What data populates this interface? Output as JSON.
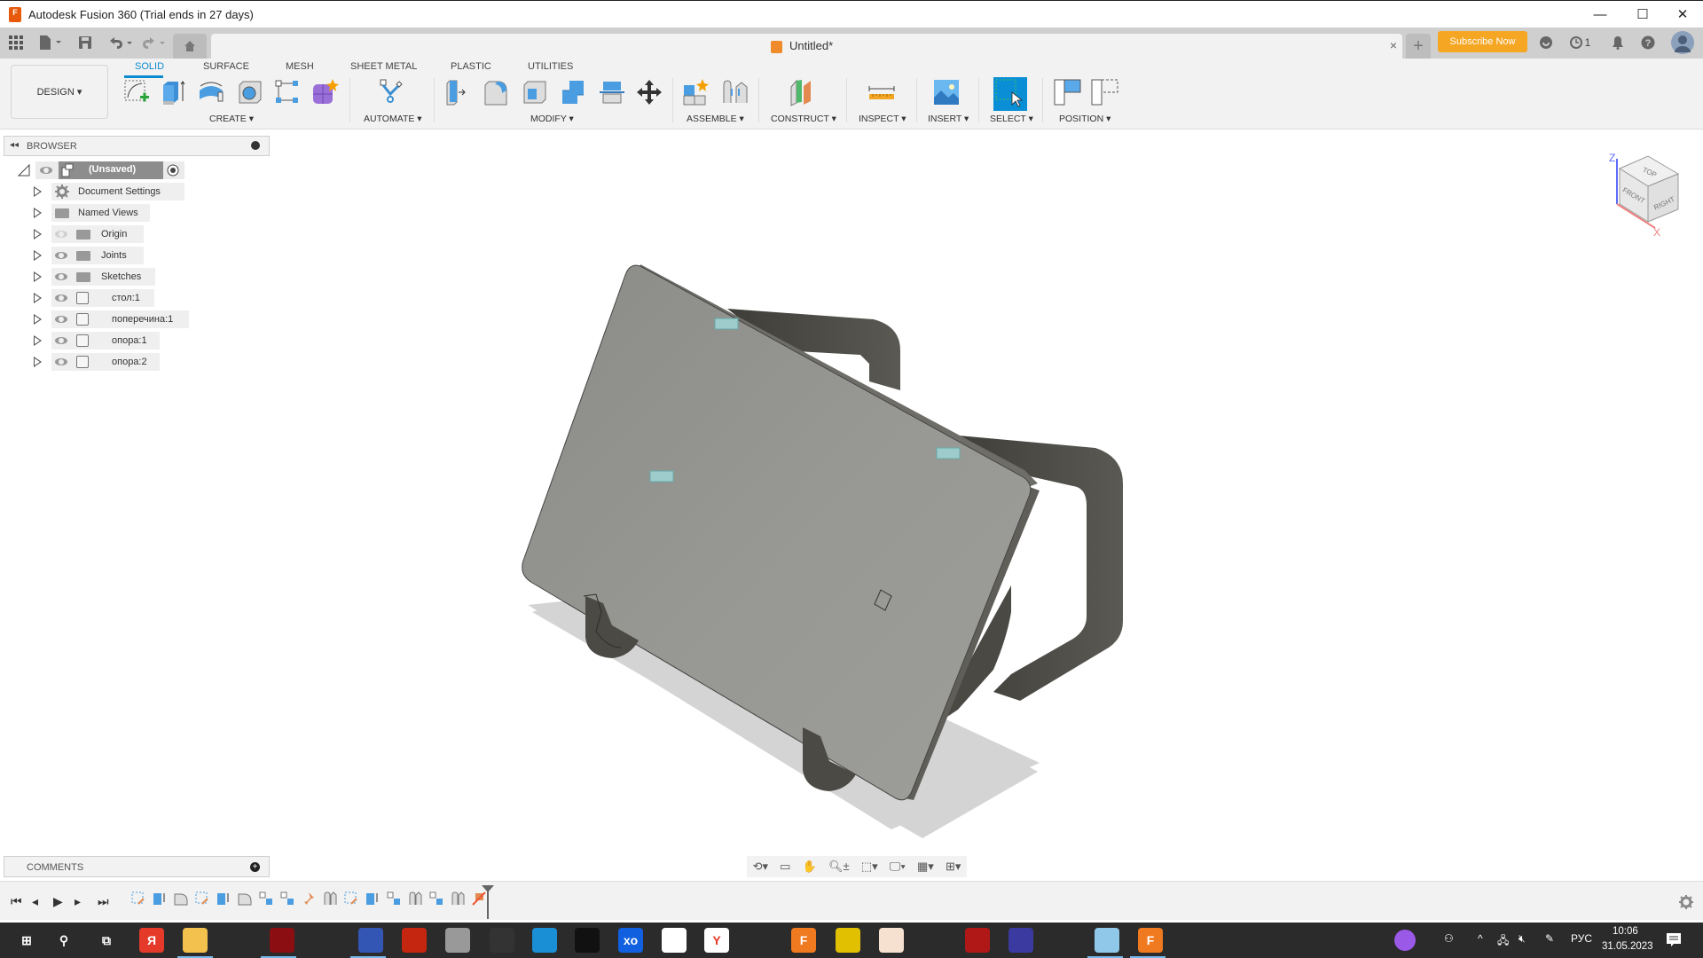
{
  "titlebar": {
    "title": "Autodesk Fusion 360 (Trial ends in 27 days)",
    "minimize": "—",
    "maximize": "☐",
    "close": "✕"
  },
  "qab": {
    "document_tab": "Untitled*",
    "tab_close": "×",
    "new_tab": "+",
    "subscribe": "Subscribe Now",
    "job_count": "1"
  },
  "ribbon": {
    "workspace": "DESIGN ▾",
    "tabs": [
      {
        "label": "SOLID",
        "active": true
      },
      {
        "label": "SURFACE"
      },
      {
        "label": "MESH"
      },
      {
        "label": "SHEET METAL"
      },
      {
        "label": "PLASTIC"
      },
      {
        "label": "UTILITIES"
      }
    ],
    "groups": [
      {
        "label": "CREATE ▾",
        "icons": [
          "create-sketch-icon",
          "extrude-icon",
          "revolve-icon",
          "hole-icon",
          "pattern-icon",
          "form-icon"
        ]
      },
      {
        "label": "AUTOMATE ▾",
        "icons": [
          "automate-icon"
        ]
      },
      {
        "label": "MODIFY ▾",
        "icons": [
          "press-pull-icon",
          "fillet-icon",
          "shell-icon",
          "combine-icon",
          "split-icon",
          "move-icon"
        ]
      },
      {
        "label": "ASSEMBLE ▾",
        "icons": [
          "new-component-icon",
          "joint-icon"
        ]
      },
      {
        "label": "CONSTRUCT ▾",
        "icons": [
          "offset-plane-icon"
        ]
      },
      {
        "label": "INSPECT ▾",
        "icons": [
          "measure-icon"
        ]
      },
      {
        "label": "INSERT ▾",
        "icons": [
          "insert-image-icon"
        ]
      },
      {
        "label": "SELECT ▾",
        "icons": [
          "select-icon"
        ]
      },
      {
        "label": "POSITION ▾",
        "icons": [
          "capture-position-icon",
          "revert-position-icon"
        ]
      }
    ]
  },
  "browser": {
    "title": "BROWSER",
    "root": "(Unsaved)",
    "items": [
      {
        "label": "Document Settings",
        "icon": "gear"
      },
      {
        "label": "Named Views",
        "icon": "folder"
      },
      {
        "label": "Origin",
        "icon": "folder",
        "hidden": true
      },
      {
        "label": "Joints",
        "icon": "folder"
      },
      {
        "label": "Sketches",
        "icon": "folder"
      },
      {
        "label": "стол:1",
        "icon": "body"
      },
      {
        "label": "поперечина:1",
        "icon": "body"
      },
      {
        "label": "опора:1",
        "icon": "body"
      },
      {
        "label": "опора:2",
        "icon": "body"
      }
    ]
  },
  "viewcube": {
    "top": "TOP",
    "front": "FRONT",
    "right": "RIGHT",
    "axis_z": "Z",
    "axis_x": "X"
  },
  "comments": {
    "title": "COMMENTS"
  },
  "timeline": {
    "features": [
      "sketch",
      "extrude",
      "fillet",
      "sketch",
      "extrude",
      "fillet",
      "component",
      "component",
      "ground",
      "joint",
      "sketch",
      "extrude",
      "component",
      "joint",
      "component",
      "joint",
      "ground-suppressed"
    ]
  },
  "taskbar": {
    "apps": [
      "start",
      "search",
      "task-view",
      "yandex",
      "explorer",
      "app-c",
      "app-i",
      "dp",
      "save-app",
      "fusion-gear",
      "app-gear",
      "autodesk",
      "edge",
      "recorder",
      "xo",
      "autocad",
      "yandex-browser",
      "ccleaner",
      "fusion360",
      "app-rad",
      "sublime",
      "upwork",
      "driver-app",
      "remote",
      "app-k",
      "notepad",
      "fusion360-active"
    ],
    "lang": "РУС",
    "time": "10:06",
    "date": "31.05.2023"
  },
  "colors": {
    "accent": "#0b8ad1",
    "subscribe": "#f5a623",
    "model_top": "#949490",
    "model_frame": "#55544e"
  }
}
